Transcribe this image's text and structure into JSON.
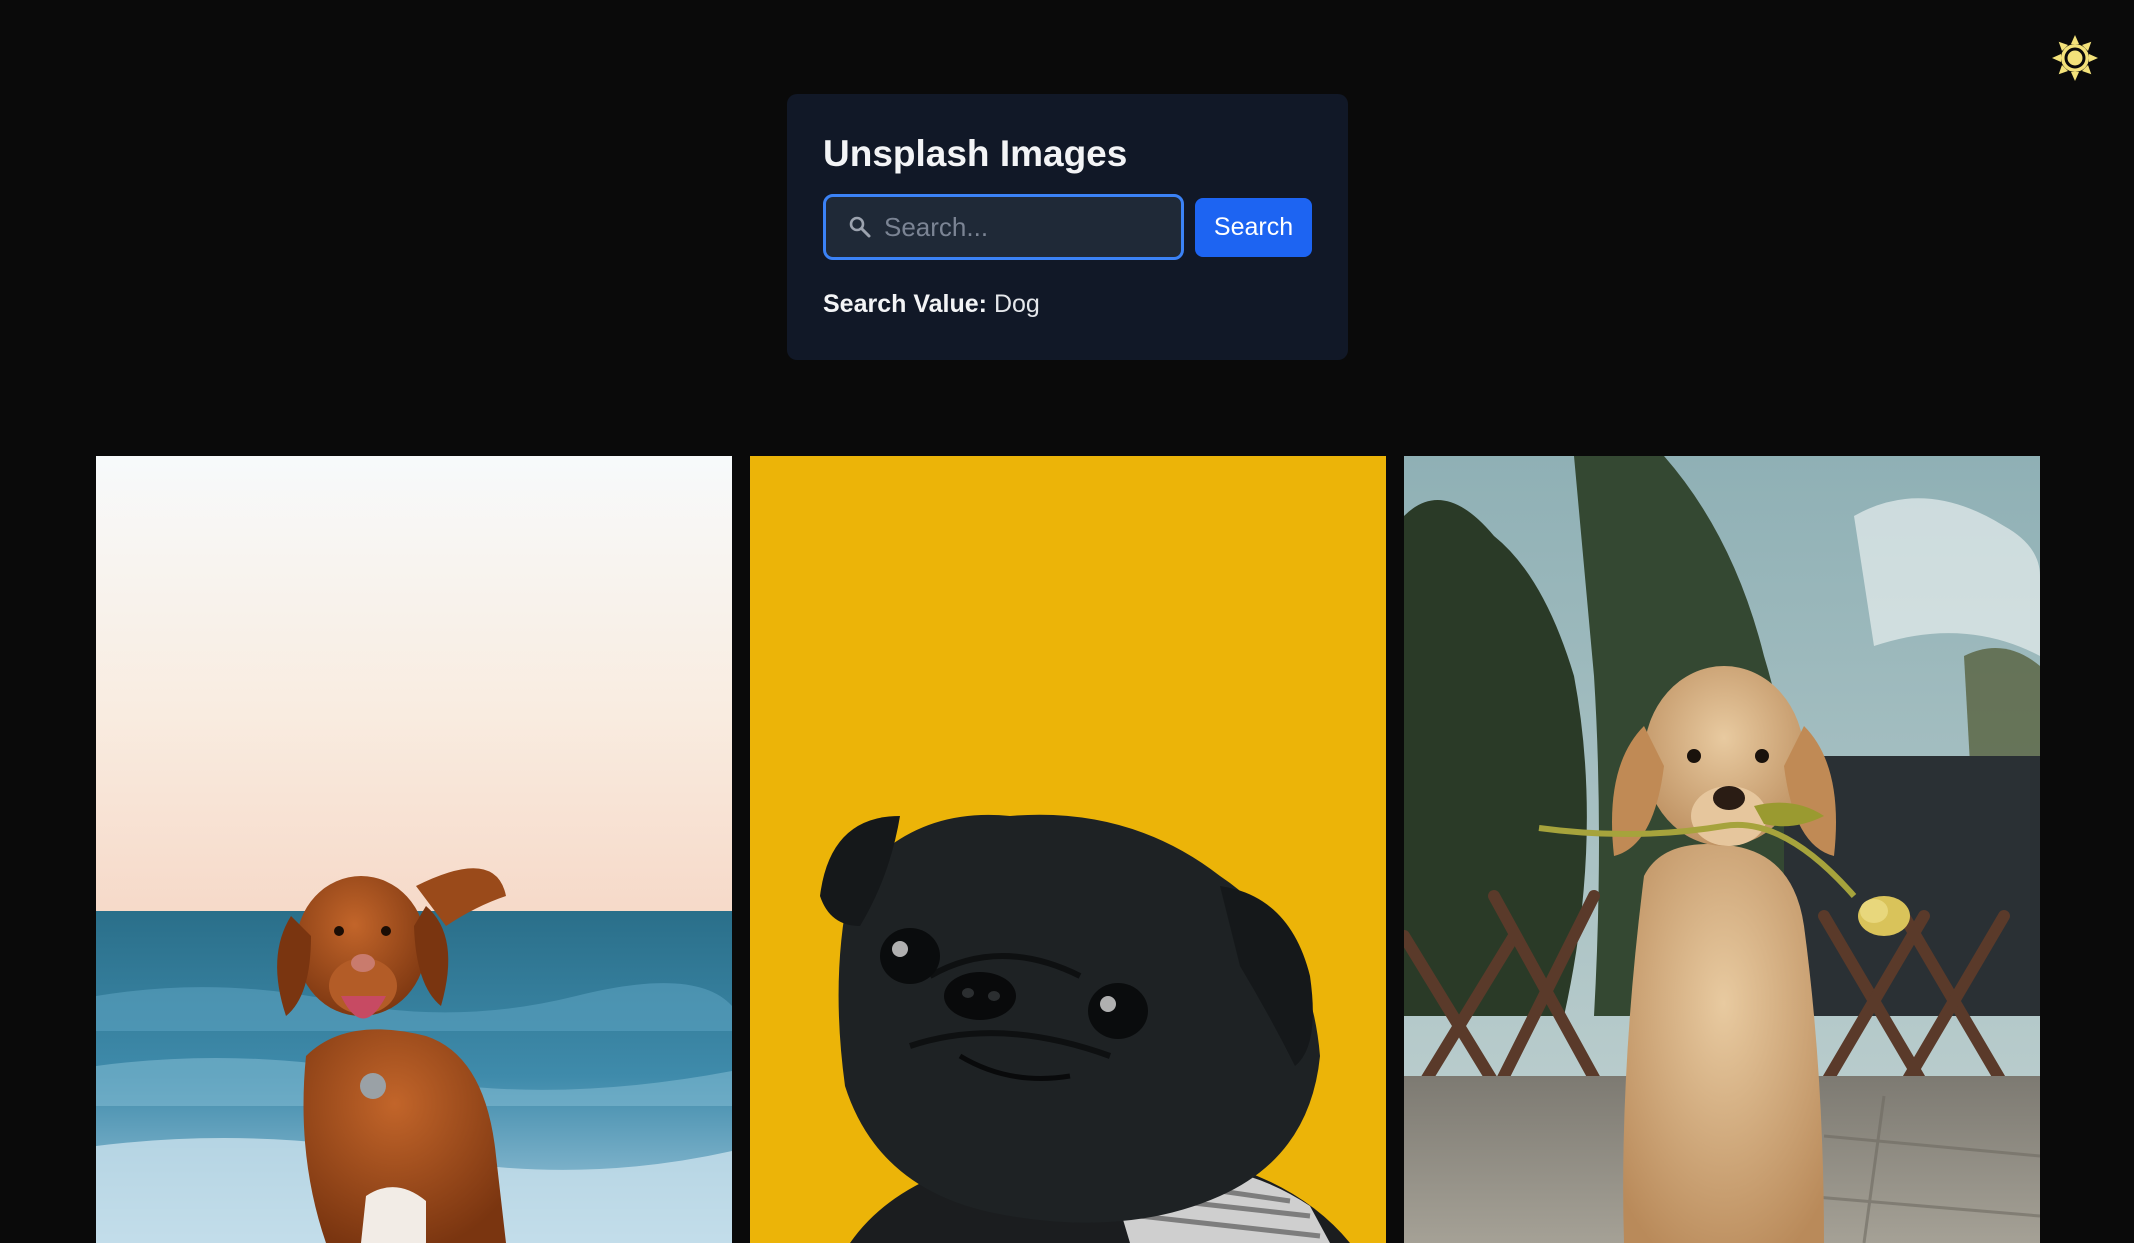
{
  "header": {
    "theme_toggle_icon": "sun-icon",
    "theme_icon_color": "#f3e27a"
  },
  "search_card": {
    "title": "Unsplash Images",
    "search_placeholder": "Search...",
    "search_input_value": "",
    "search_button_label": "Search",
    "search_value_label": "Search Value:",
    "search_value": "Dog"
  },
  "gallery": {
    "images": [
      {
        "subject": "brown dog running on beach"
      },
      {
        "subject": "black pug on yellow background"
      },
      {
        "subject": "golden retriever puppy holding tulip"
      }
    ]
  },
  "colors": {
    "background": "#0a0a0a",
    "card": "#111827",
    "accent": "#1d64f2",
    "focus_ring": "#3b82f6"
  }
}
